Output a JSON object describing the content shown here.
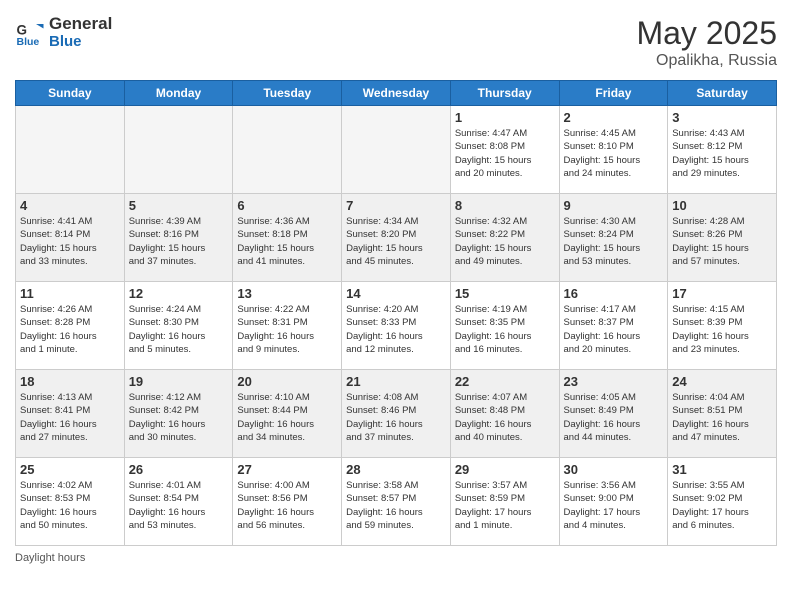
{
  "header": {
    "logo_line1": "General",
    "logo_line2": "Blue",
    "title": "May 2025",
    "subtitle": "Opalikha, Russia"
  },
  "days": [
    "Sunday",
    "Monday",
    "Tuesday",
    "Wednesday",
    "Thursday",
    "Friday",
    "Saturday"
  ],
  "weeks": [
    [
      {
        "day": "",
        "info": ""
      },
      {
        "day": "",
        "info": ""
      },
      {
        "day": "",
        "info": ""
      },
      {
        "day": "",
        "info": ""
      },
      {
        "day": "1",
        "info": "Sunrise: 4:47 AM\nSunset: 8:08 PM\nDaylight: 15 hours\nand 20 minutes."
      },
      {
        "day": "2",
        "info": "Sunrise: 4:45 AM\nSunset: 8:10 PM\nDaylight: 15 hours\nand 24 minutes."
      },
      {
        "day": "3",
        "info": "Sunrise: 4:43 AM\nSunset: 8:12 PM\nDaylight: 15 hours\nand 29 minutes."
      }
    ],
    [
      {
        "day": "4",
        "info": "Sunrise: 4:41 AM\nSunset: 8:14 PM\nDaylight: 15 hours\nand 33 minutes."
      },
      {
        "day": "5",
        "info": "Sunrise: 4:39 AM\nSunset: 8:16 PM\nDaylight: 15 hours\nand 37 minutes."
      },
      {
        "day": "6",
        "info": "Sunrise: 4:36 AM\nSunset: 8:18 PM\nDaylight: 15 hours\nand 41 minutes."
      },
      {
        "day": "7",
        "info": "Sunrise: 4:34 AM\nSunset: 8:20 PM\nDaylight: 15 hours\nand 45 minutes."
      },
      {
        "day": "8",
        "info": "Sunrise: 4:32 AM\nSunset: 8:22 PM\nDaylight: 15 hours\nand 49 minutes."
      },
      {
        "day": "9",
        "info": "Sunrise: 4:30 AM\nSunset: 8:24 PM\nDaylight: 15 hours\nand 53 minutes."
      },
      {
        "day": "10",
        "info": "Sunrise: 4:28 AM\nSunset: 8:26 PM\nDaylight: 15 hours\nand 57 minutes."
      }
    ],
    [
      {
        "day": "11",
        "info": "Sunrise: 4:26 AM\nSunset: 8:28 PM\nDaylight: 16 hours\nand 1 minute."
      },
      {
        "day": "12",
        "info": "Sunrise: 4:24 AM\nSunset: 8:30 PM\nDaylight: 16 hours\nand 5 minutes."
      },
      {
        "day": "13",
        "info": "Sunrise: 4:22 AM\nSunset: 8:31 PM\nDaylight: 16 hours\nand 9 minutes."
      },
      {
        "day": "14",
        "info": "Sunrise: 4:20 AM\nSunset: 8:33 PM\nDaylight: 16 hours\nand 12 minutes."
      },
      {
        "day": "15",
        "info": "Sunrise: 4:19 AM\nSunset: 8:35 PM\nDaylight: 16 hours\nand 16 minutes."
      },
      {
        "day": "16",
        "info": "Sunrise: 4:17 AM\nSunset: 8:37 PM\nDaylight: 16 hours\nand 20 minutes."
      },
      {
        "day": "17",
        "info": "Sunrise: 4:15 AM\nSunset: 8:39 PM\nDaylight: 16 hours\nand 23 minutes."
      }
    ],
    [
      {
        "day": "18",
        "info": "Sunrise: 4:13 AM\nSunset: 8:41 PM\nDaylight: 16 hours\nand 27 minutes."
      },
      {
        "day": "19",
        "info": "Sunrise: 4:12 AM\nSunset: 8:42 PM\nDaylight: 16 hours\nand 30 minutes."
      },
      {
        "day": "20",
        "info": "Sunrise: 4:10 AM\nSunset: 8:44 PM\nDaylight: 16 hours\nand 34 minutes."
      },
      {
        "day": "21",
        "info": "Sunrise: 4:08 AM\nSunset: 8:46 PM\nDaylight: 16 hours\nand 37 minutes."
      },
      {
        "day": "22",
        "info": "Sunrise: 4:07 AM\nSunset: 8:48 PM\nDaylight: 16 hours\nand 40 minutes."
      },
      {
        "day": "23",
        "info": "Sunrise: 4:05 AM\nSunset: 8:49 PM\nDaylight: 16 hours\nand 44 minutes."
      },
      {
        "day": "24",
        "info": "Sunrise: 4:04 AM\nSunset: 8:51 PM\nDaylight: 16 hours\nand 47 minutes."
      }
    ],
    [
      {
        "day": "25",
        "info": "Sunrise: 4:02 AM\nSunset: 8:53 PM\nDaylight: 16 hours\nand 50 minutes."
      },
      {
        "day": "26",
        "info": "Sunrise: 4:01 AM\nSunset: 8:54 PM\nDaylight: 16 hours\nand 53 minutes."
      },
      {
        "day": "27",
        "info": "Sunrise: 4:00 AM\nSunset: 8:56 PM\nDaylight: 16 hours\nand 56 minutes."
      },
      {
        "day": "28",
        "info": "Sunrise: 3:58 AM\nSunset: 8:57 PM\nDaylight: 16 hours\nand 59 minutes."
      },
      {
        "day": "29",
        "info": "Sunrise: 3:57 AM\nSunset: 8:59 PM\nDaylight: 17 hours\nand 1 minute."
      },
      {
        "day": "30",
        "info": "Sunrise: 3:56 AM\nSunset: 9:00 PM\nDaylight: 17 hours\nand 4 minutes."
      },
      {
        "day": "31",
        "info": "Sunrise: 3:55 AM\nSunset: 9:02 PM\nDaylight: 17 hours\nand 6 minutes."
      }
    ]
  ],
  "footer": "Daylight hours"
}
